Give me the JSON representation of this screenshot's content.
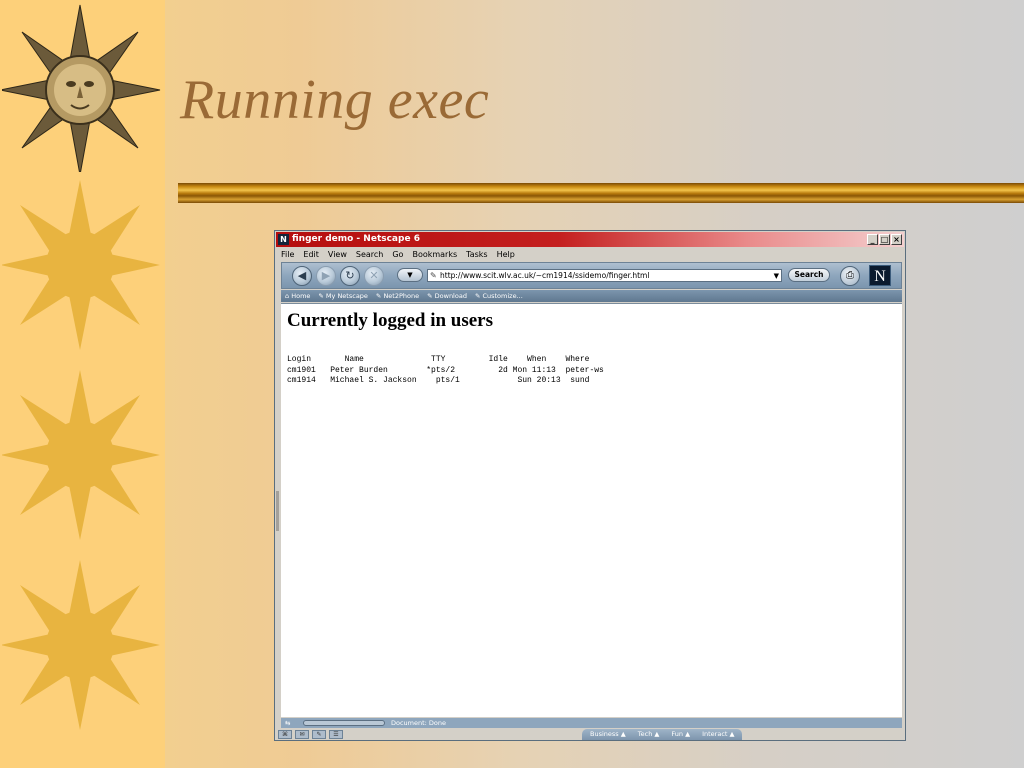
{
  "slide": {
    "title": "Running exec"
  },
  "browser": {
    "window_title": "finger demo - Netscape 6",
    "window_buttons": [
      "_",
      "□",
      "×"
    ],
    "menu": [
      "File",
      "Edit",
      "View",
      "Search",
      "Go",
      "Bookmarks",
      "Tasks",
      "Help"
    ],
    "url": "http://www.scit.wlv.ac.uk/~cm1914/ssidemo/finger.html",
    "search_label": "Search",
    "personal_toolbar": [
      "Home",
      "My Netscape",
      "Net2Phone",
      "Download",
      "Customize..."
    ],
    "status_text": "Document: Done",
    "sidebar_tabs": [
      "Business",
      "Tech",
      "Fun",
      "Interact"
    ]
  },
  "page": {
    "heading": "Currently logged in users",
    "finger_output": {
      "header": "Login       Name              TTY         Idle    When    Where",
      "rows": [
        "cm1901   Peter Burden        *pts/2         2d Mon 11:13  peter-ws",
        "cm1914   Michael S. Jackson    pts/1            Sun 20:13  sund"
      ]
    }
  },
  "colors": {
    "title": "#9a6a36",
    "titlebar_start": "#b50e0e",
    "accent_gold": "#c98a12"
  },
  "icons": [
    "sun-icon",
    "netscape-logo-icon",
    "back-icon",
    "forward-icon",
    "reload-icon",
    "stop-icon",
    "print-icon",
    "netscape-n-icon"
  ]
}
